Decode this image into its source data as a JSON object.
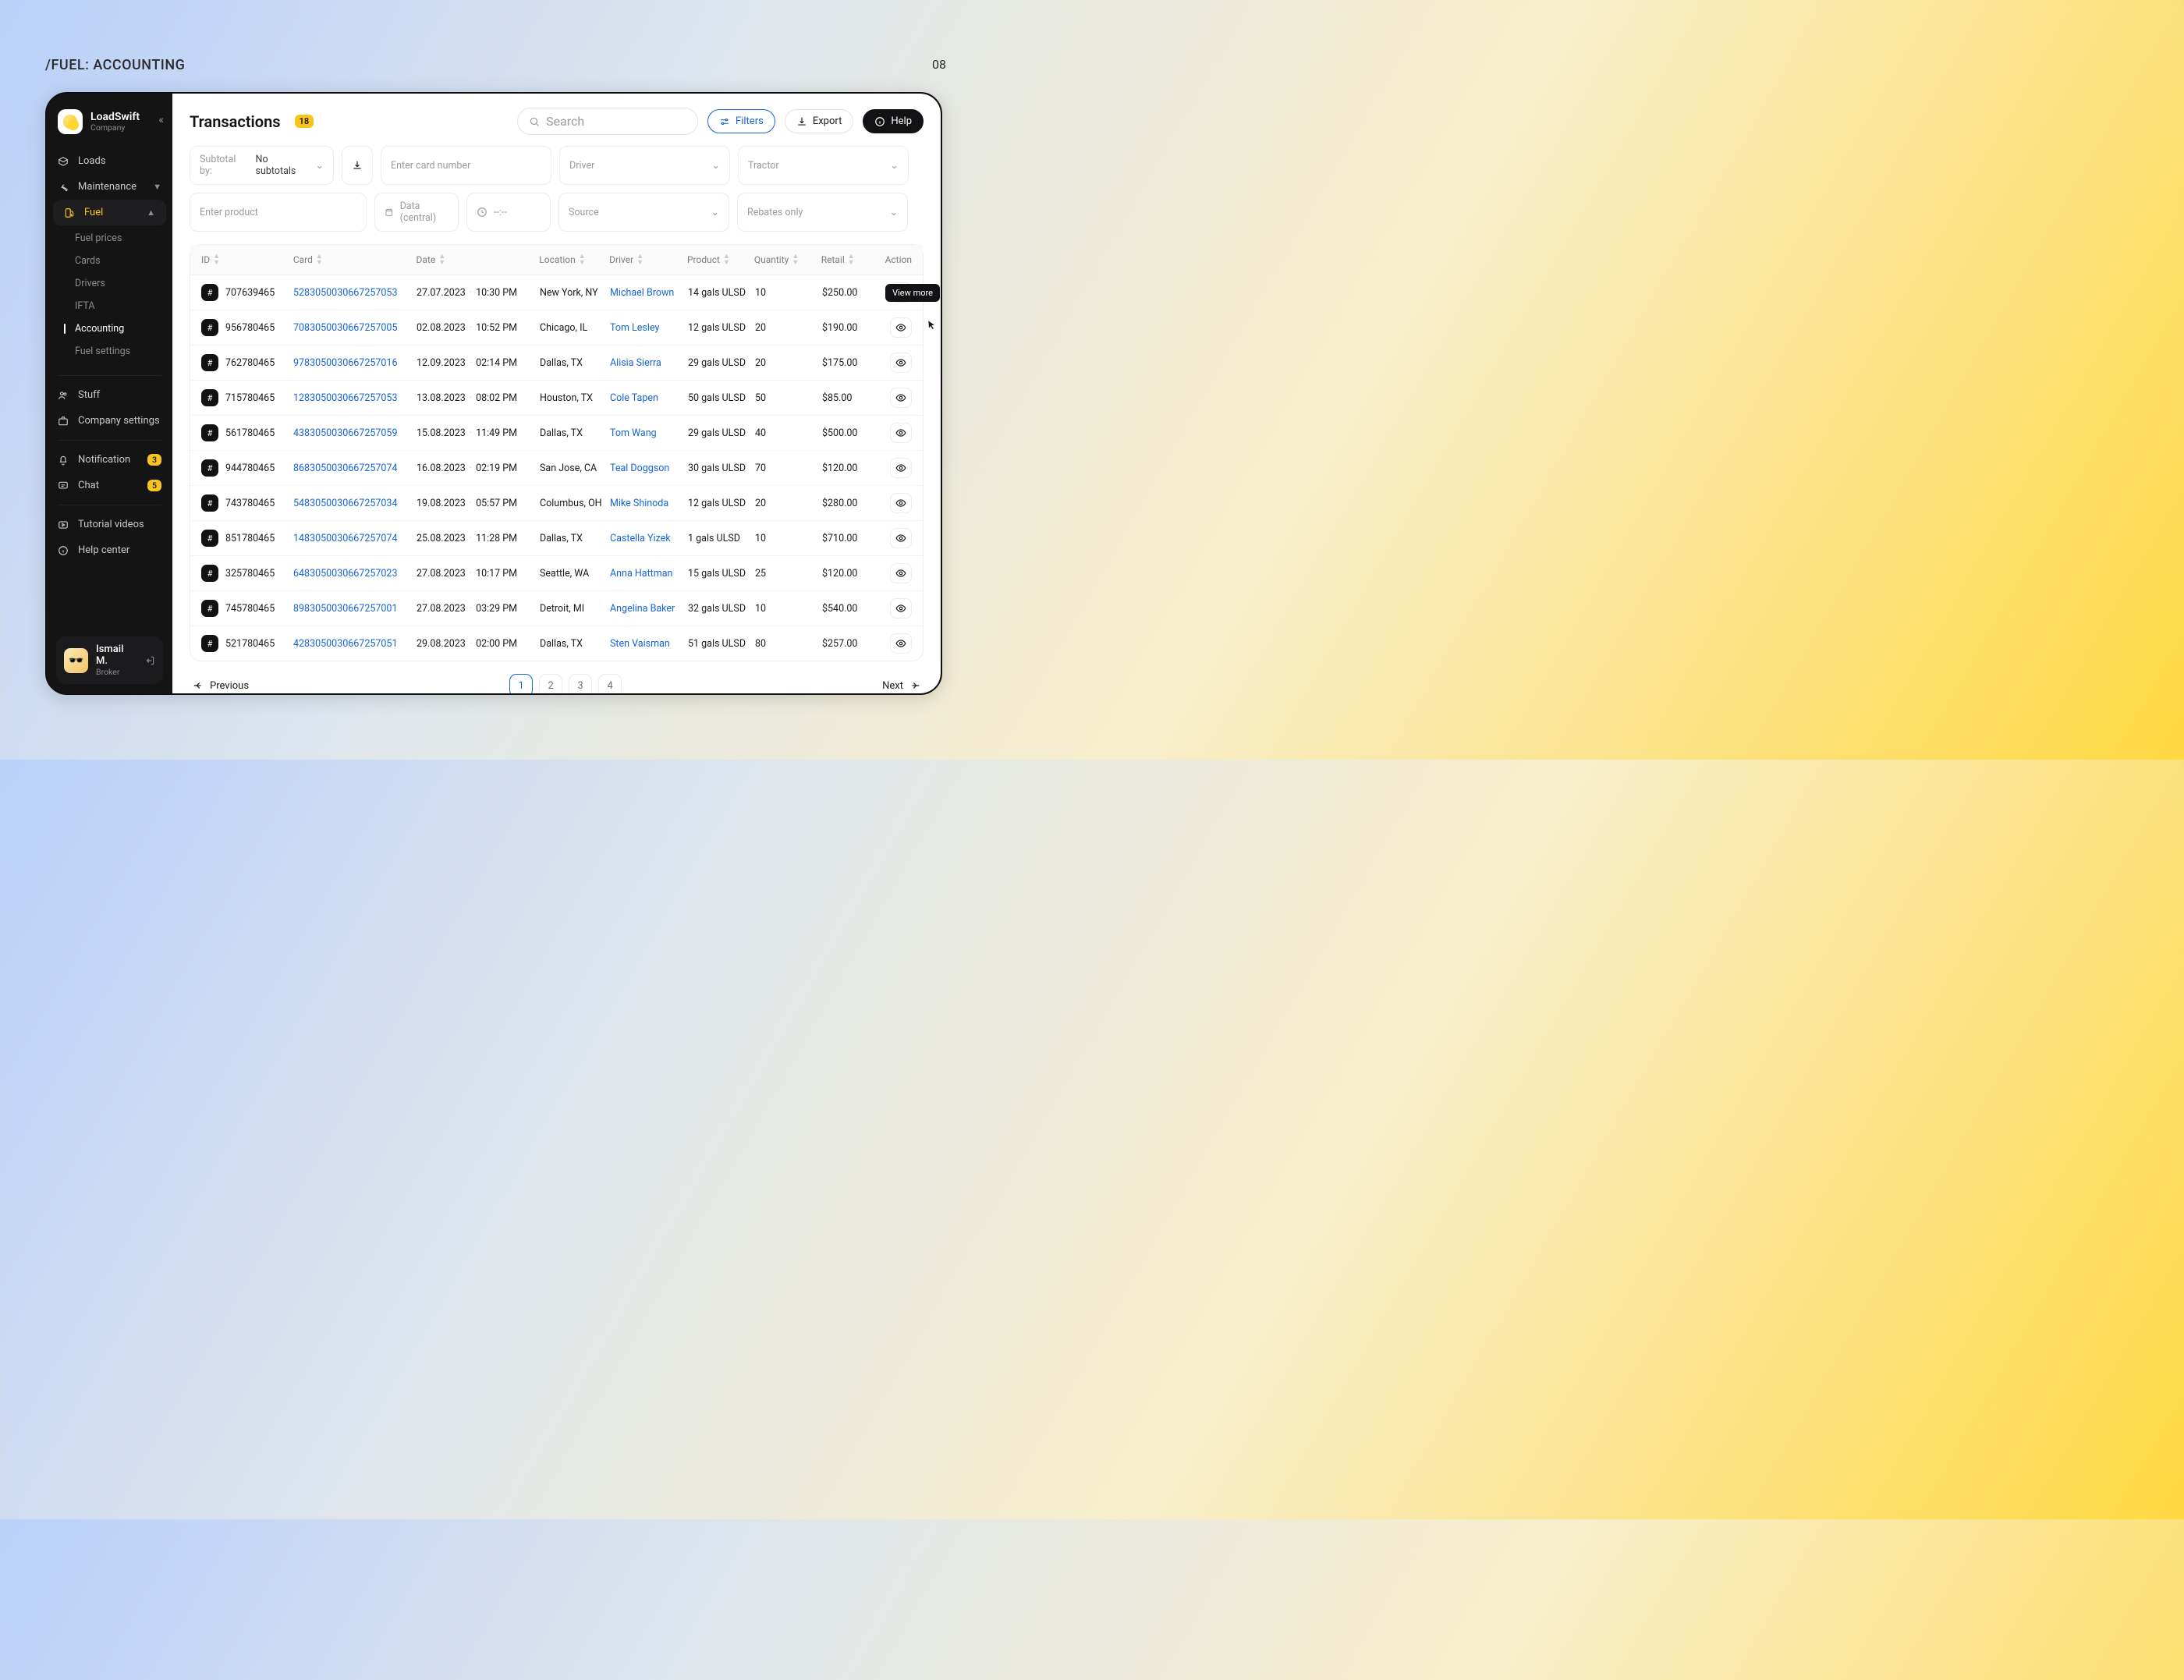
{
  "bg": {
    "label": "/FUEL: ACCOUNTING",
    "page": "08"
  },
  "brand": {
    "name": "LoadSwift",
    "sub": "Company"
  },
  "nav": {
    "loads": "Loads",
    "maint": "Maintenance",
    "fuel": "Fuel",
    "fuel_sub": [
      "Fuel prices",
      "Cards",
      "Drivers",
      "IFTA",
      "Accounting",
      "Fuel settings"
    ],
    "stuff": "Stuff",
    "company": "Company settings",
    "notif": "Notification",
    "notif_badge": "3",
    "chat": "Chat",
    "chat_badge": "5",
    "tutorial": "Tutorial videos",
    "help": "Help center"
  },
  "user": {
    "name": "Ismail M.",
    "role": "Broker"
  },
  "header": {
    "title": "Transactions",
    "count": "18",
    "search_ph": "Search",
    "filters": "Filters",
    "export": "Export",
    "help": "Help"
  },
  "filters": {
    "subtotal_lbl": "Subtotal by:",
    "subtotal_val": "No subtotals",
    "card_ph": "Enter card number",
    "driver_ph": "Driver",
    "tractor_ph": "Tractor",
    "product_ph": "Enter product",
    "date_ph": "Data (central)",
    "time_ph": "--:--",
    "source_ph": "Source",
    "rebates_ph": "Rebates only"
  },
  "columns": {
    "id": "ID",
    "card": "Card",
    "date": "Date",
    "loc": "Location",
    "drv": "Driver",
    "prod": "Product",
    "qty": "Quantity",
    "ret": "Retail",
    "act": "Action"
  },
  "rows": [
    {
      "id": "707639465",
      "card": "52830500306672570­53",
      "card_raw": "5283050030667257053",
      "date": "27.07.2023",
      "time": "10:30 PM",
      "loc": "New York, NY",
      "driver": "Michael Brown",
      "product": "14 gals ULSD",
      "qty": "10",
      "retail": "$250.00"
    },
    {
      "id": "956780465",
      "card": "7083050030667257005",
      "date": "02.08.2023",
      "time": "10:52 PM",
      "loc": "Chicago, IL",
      "driver": "Tom Lesley",
      "product": "12 gals ULSD",
      "qty": "20",
      "retail": "$190.00"
    },
    {
      "id": "762780465",
      "card": "9783050030667257016",
      "date": "12.09.2023",
      "time": "02:14 PM",
      "loc": "Dallas, TX",
      "driver": "Alisia Sierra",
      "product": "29 gals ULSD",
      "qty": "20",
      "retail": "$175.00"
    },
    {
      "id": "715780465",
      "card": "1283050030667257053",
      "date": "13.08.2023",
      "time": "08:02 PM",
      "loc": "Houston, TX",
      "driver": "Cole Tapen",
      "product": "50 gals ULSD",
      "qty": "50",
      "retail": "$85.00"
    },
    {
      "id": "561780465",
      "card": "4383050030667257059",
      "date": "15.08.2023",
      "time": "11:49 PM",
      "loc": "Dallas, TX",
      "driver": "Tom Wang",
      "product": "29 gals ULSD",
      "qty": "40",
      "retail": "$500.00"
    },
    {
      "id": "944780465",
      "card": "8683050030667257074",
      "date": "16.08.2023",
      "time": "02:19 PM",
      "loc": "San Jose, CA",
      "driver": "Teal Doggson",
      "product": "30 gals ULSD",
      "qty": "70",
      "retail": "$120.00"
    },
    {
      "id": "743780465",
      "card": "5483050030667257034",
      "date": "19.08.2023",
      "time": "05:57 PM",
      "loc": "Columbus, OH",
      "driver": "Mike Shinoda",
      "product": "12 gals ULSD",
      "qty": "20",
      "retail": "$280.00"
    },
    {
      "id": "851780465",
      "card": "1483050030667257074",
      "date": "25.08.2023",
      "time": "11:28 PM",
      "loc": "Dallas, TX",
      "driver": "Castella Yizek",
      "product": "1 gals ULSD",
      "qty": "10",
      "retail": "$710.00"
    },
    {
      "id": "325780465",
      "card": "6483050030667257023",
      "date": "27.08.2023",
      "time": "10:17 PM",
      "loc": "Seattle, WA",
      "driver": "Anna Hattman",
      "product": "15 gals ULSD",
      "qty": "25",
      "retail": "$120.00"
    },
    {
      "id": "745780465",
      "card": "8983050030667257001",
      "date": "27.08.2023",
      "time": "03:29 PM",
      "loc": "Detroit, MI",
      "driver": "Angelina Baker",
      "product": "32 gals ULSD",
      "qty": "10",
      "retail": "$540.00"
    },
    {
      "id": "521780465",
      "card": "4283050030667257051",
      "date": "29.08.2023",
      "time": "02:00 PM",
      "loc": "Dallas, TX",
      "driver": "Sten Vaisman",
      "product": "51 gals ULSD",
      "qty": "80",
      "retail": "$257.00"
    }
  ],
  "tooltip": "View more",
  "pager": {
    "prev": "Previous",
    "next": "Next",
    "pages": [
      "1",
      "2",
      "3",
      "4"
    ],
    "current": 0
  }
}
